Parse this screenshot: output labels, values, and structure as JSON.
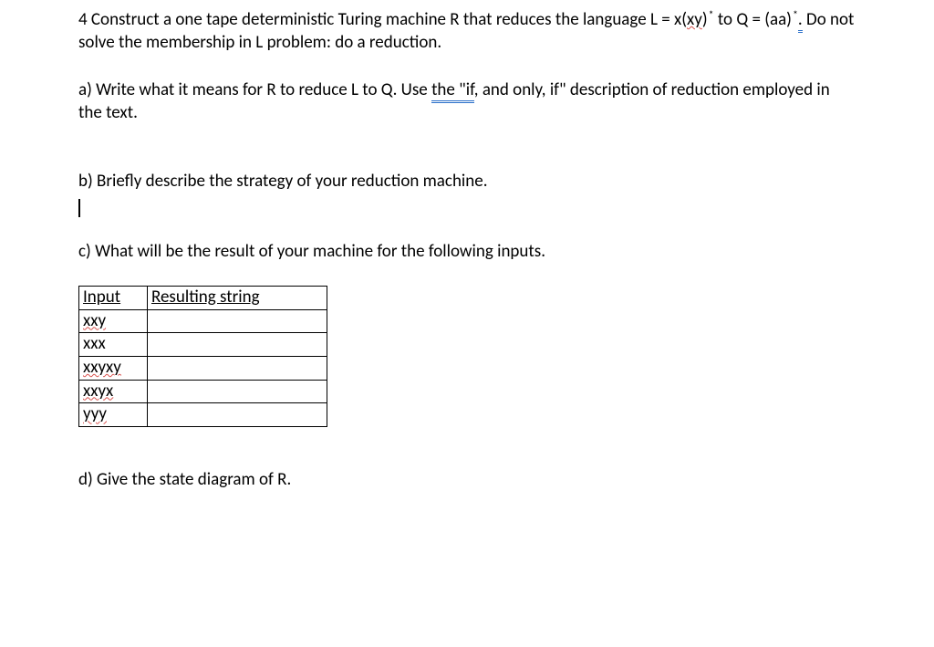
{
  "q4": {
    "line1_pre": "4 Construct a one tape deterministic Turing machine R that reduces the language L = x(",
    "line1_xy": "xy",
    "line1_mid": ")",
    "line1_star": "*",
    "line1_mid2": " to Q = (aa)",
    "line1_star2": "*",
    "line1_dot": ".",
    "line1_post": " Do not solve the membership in L problem: do a reduction."
  },
  "qa": {
    "pre": "a) Write what it means for R to reduce L to Q.  Use ",
    "blue1": "the ",
    "blue2": "\"if",
    "mid": ", and only, if\" description of reduction employed in the text."
  },
  "qb": {
    "text": "b) Briefly describe the strategy of your reduction machine."
  },
  "qc": {
    "text": "c) What will be the result of your machine for the following inputs.",
    "th1": "Input",
    "th2": "Resulting string",
    "rows": [
      "xxy",
      "xxx",
      "xxyxy",
      "xxyx",
      "yyy"
    ]
  },
  "qd": {
    "text": "d) Give the state diagram of R."
  }
}
